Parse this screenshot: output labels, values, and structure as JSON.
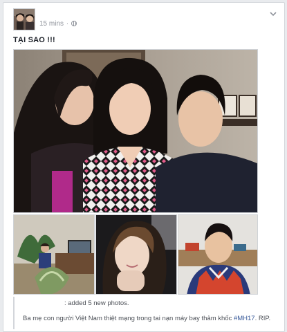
{
  "post": {
    "time": "15 mins",
    "dot": "·",
    "privacy_icon": "globe-icon",
    "options_icon": "chevron-down-icon",
    "text": "TẠI SAO !!!",
    "photos": [
      {
        "icon": "photo-family"
      },
      {
        "icon": "photo-living-room"
      },
      {
        "icon": "photo-girl-selfie"
      },
      {
        "icon": "photo-boy"
      }
    ]
  },
  "shared_post": {
    "action": ": added 5 new photos.",
    "message": "Ba mẹ con người Việt Nam thiệt mạng trong tai nạn máy bay thảm khốc ",
    "hashtag": "#MH17",
    "suffix": ". RIP."
  },
  "colors": {
    "link": "#365899",
    "muted": "#90949c",
    "border": "#d3d6db"
  }
}
